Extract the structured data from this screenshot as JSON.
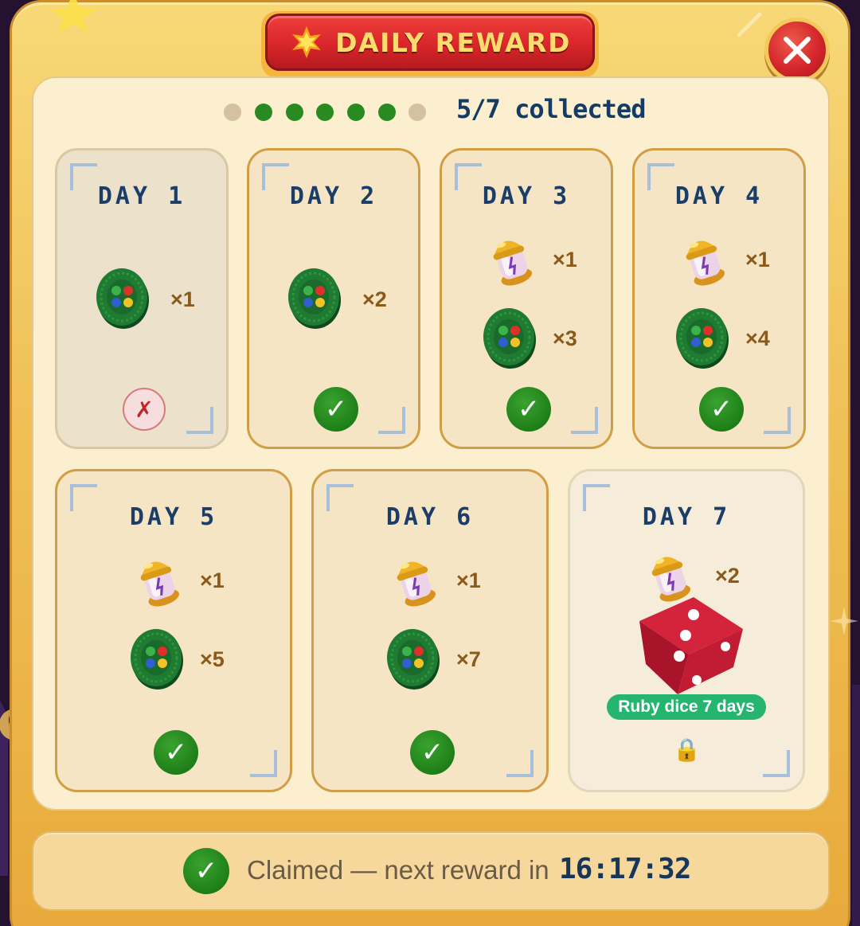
{
  "header": {
    "title": "DAILY REWARD",
    "close_label": "close"
  },
  "progress": {
    "dots": [
      false,
      true,
      true,
      true,
      true,
      true,
      false
    ],
    "collected_text": "5/7 collected"
  },
  "days": [
    {
      "label": "DAY 1",
      "status": "missed",
      "status_glyph": "✗",
      "rewards": [
        {
          "item": "green-coin-icon",
          "qty": "×1"
        }
      ]
    },
    {
      "label": "DAY 2",
      "status": "claimed",
      "status_glyph": "✓",
      "rewards": [
        {
          "item": "green-coin-icon",
          "qty": "×2"
        }
      ]
    },
    {
      "label": "DAY 3",
      "status": "claimed",
      "status_glyph": "✓",
      "rewards": [
        {
          "item": "golden-capsule-icon",
          "qty": "×1"
        },
        {
          "item": "green-coin-icon",
          "qty": "×3"
        }
      ]
    },
    {
      "label": "DAY 4",
      "status": "claimed",
      "status_glyph": "✓",
      "rewards": [
        {
          "item": "golden-capsule-icon",
          "qty": "×1"
        },
        {
          "item": "green-coin-icon",
          "qty": "×4"
        }
      ]
    },
    {
      "label": "DAY 5",
      "status": "claimed",
      "status_glyph": "✓",
      "rewards": [
        {
          "item": "golden-capsule-icon",
          "qty": "×1"
        },
        {
          "item": "green-coin-icon",
          "qty": "×5"
        }
      ]
    },
    {
      "label": "DAY 6",
      "status": "claimed",
      "status_glyph": "✓",
      "rewards": [
        {
          "item": "golden-capsule-icon",
          "qty": "×1"
        },
        {
          "item": "green-coin-icon",
          "qty": "×7"
        }
      ]
    },
    {
      "label": "DAY 7",
      "status": "locked",
      "status_glyph": "🔒",
      "rewards": [
        {
          "item": "golden-capsule-icon",
          "qty": "×2"
        },
        {
          "item": "ruby-dice-icon",
          "qty": ""
        }
      ],
      "badge": "Ruby dice 7 days"
    }
  ],
  "footer": {
    "check_glyph": "✓",
    "status_text": "Claimed — next reward in",
    "timer": "16:17:32"
  },
  "colors": {
    "panel": "#f0c259",
    "title_red": "#d8262a",
    "title_text": "#fbdc6c",
    "check_green": "#22841b",
    "badge_green": "#25b56f",
    "day_label": "#1a3e68",
    "qty_text": "#8a5a1a"
  }
}
